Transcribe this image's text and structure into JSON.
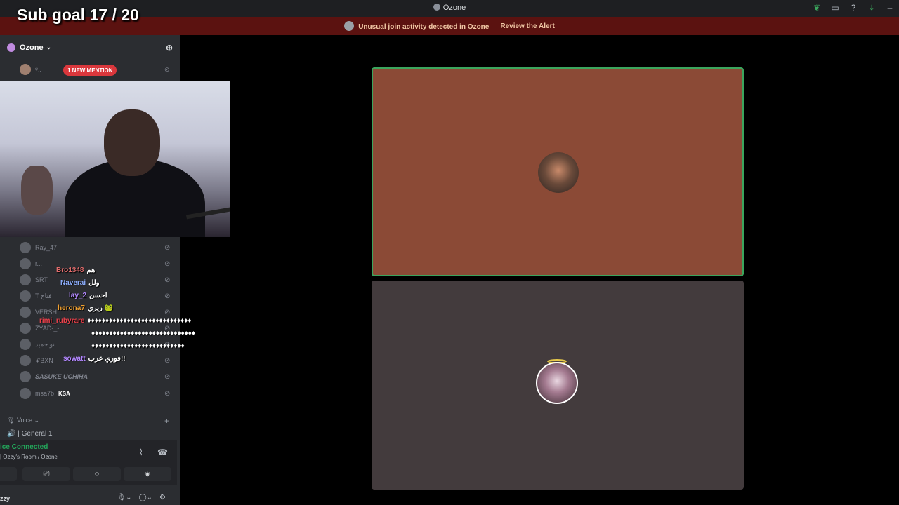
{
  "overlay": {
    "subgoal_text": "Sub goal 17 / 20"
  },
  "window": {
    "title": "Ozone",
    "icons": [
      "leaf-icon",
      "screen-icon",
      "help-icon",
      "download-icon",
      "minimize-icon"
    ]
  },
  "alert": {
    "message": "Unusual join activity detected in Ozone",
    "link_label": "Review the Alert"
  },
  "sidebar": {
    "server_name": "Ozone",
    "mention_badge": "1 NEW MENTION",
    "members": [
      {
        "name": "Ray_47"
      },
      {
        "name": "r..."
      },
      {
        "name": "SRT"
      },
      {
        "name": "T فتاح"
      },
      {
        "name": "VERSH"
      },
      {
        "name": "ZYAD-_-"
      },
      {
        "name": "نو حميد"
      },
      {
        "name": "ꗃBXN"
      },
      {
        "name": "SASUKE UCHIHA"
      },
      {
        "name": "msa7b",
        "tag": "KSA"
      }
    ],
    "voice_category": "Voice",
    "voice_channel": "General 1",
    "voice_status": "ice Connected",
    "voice_room": "| Ozzy's Room / Ozone",
    "user_name": "zzy"
  },
  "chat": [
    {
      "user": "Bro1348",
      "message": "هم",
      "color": "#e06b6b"
    },
    {
      "user": "Naverai",
      "message": "ولل",
      "color": "#8fb0ff"
    },
    {
      "user": "lay_2",
      "message": "احسن",
      "color": "#b388ff"
    },
    {
      "user": "herona7",
      "message": "زيري 🐸",
      "color": "#f0a030"
    },
    {
      "user": "rimi_rubyrare",
      "message": "♦♦♦♦♦♦♦♦♦♦♦♦♦♦♦♦♦♦♦♦♦♦♦♦♦♦♦♦♦",
      "color": "#e8404a"
    },
    {
      "user": "",
      "message": "♦♦♦♦♦♦♦♦♦♦♦♦♦♦♦♦♦♦♦♦♦♦♦♦♦♦♦♦♦",
      "color": "#ffffff"
    },
    {
      "user": "",
      "message": "♦♦♦♦♦♦♦♦♦♦♦♦♦♦♦♦♦♦♦♦♦♦♦♦♦♦",
      "color": "#ffffff"
    },
    {
      "user": "sowatt",
      "message": "فوري عرب!!",
      "color": "#b388ff"
    }
  ],
  "colors": {
    "speaking_border": "#3ba55d",
    "tile1_bg": "#8b4a36",
    "tile2_bg": "#433b3d",
    "connected": "#23a55a",
    "alert_bg": "#5b1210"
  }
}
